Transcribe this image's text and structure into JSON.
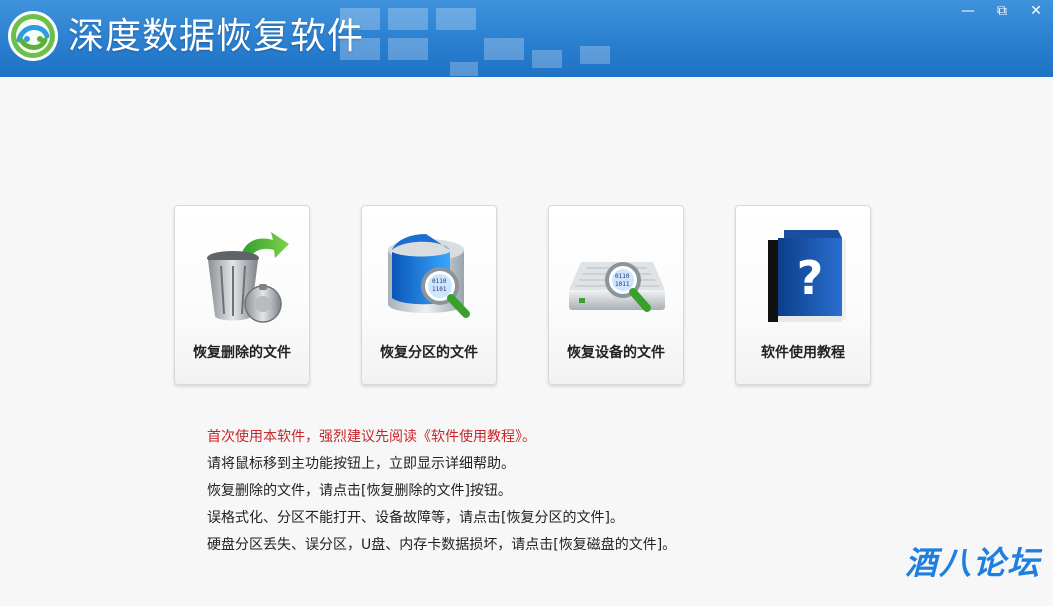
{
  "app": {
    "title": "深度数据恢复软件"
  },
  "window_controls": {
    "minimize": "—",
    "maximize": "⧉",
    "close": "✕"
  },
  "cards": [
    {
      "label": "恢复删除的文件",
      "icon": "recycle-bin-icon"
    },
    {
      "label": "恢复分区的文件",
      "icon": "partition-disk-icon"
    },
    {
      "label": "恢复设备的文件",
      "icon": "device-drive-icon"
    },
    {
      "label": "软件使用教程",
      "icon": "help-book-icon"
    }
  ],
  "hints": [
    "首次使用本软件，强烈建议先阅读《软件使用教程》。",
    "请将鼠标移到主功能按钮上，立即显示详细帮助。",
    "恢复删除的文件，请点击[恢复删除的文件]按钮。",
    "误格式化、分区不能打开、设备故障等，请点击[恢复分区的文件]。",
    "硬盘分区丢失、误分区，U盘、内存卡数据损坏，请点击[恢复磁盘的文件]。"
  ],
  "watermark": "酒八论坛",
  "colors": {
    "titlebar": "#2a7fd0",
    "warning_text": "#c8262b",
    "watermark": "#1d7fe0"
  }
}
